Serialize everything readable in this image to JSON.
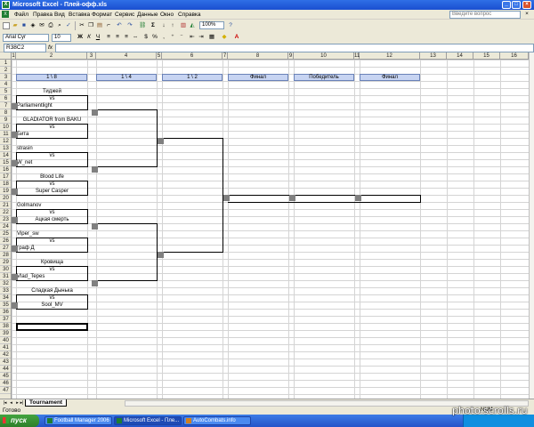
{
  "window": {
    "title": "Microsoft Excel - Плей-офф.xls"
  },
  "menu": [
    "Файл",
    "Правка",
    "Вид",
    "Вставка",
    "Формат",
    "Сервис",
    "Данные",
    "Окно",
    "Справка"
  ],
  "help_placeholder": "Введите вопрос",
  "toolbar": {
    "zoom": "100%",
    "font": "Arial Cyr",
    "font_size": "10"
  },
  "formula_bar": {
    "name_box": "R38C2",
    "fx": "fx",
    "formula": ""
  },
  "columns": [
    "1",
    "2",
    "3",
    "4",
    "5",
    "6",
    "7",
    "8",
    "9",
    "10",
    "11",
    "12",
    "13",
    "14",
    "15",
    "16"
  ],
  "rows": [
    "1",
    "2",
    "3",
    "4",
    "5",
    "6",
    "7",
    "8",
    "9",
    "10",
    "11",
    "12",
    "13",
    "14",
    "15",
    "16",
    "17",
    "18",
    "19",
    "20",
    "21",
    "22",
    "23",
    "24",
    "25",
    "26",
    "27",
    "28",
    "29",
    "30",
    "31",
    "32",
    "33",
    "34",
    "35",
    "36",
    "37",
    "38",
    "39",
    "40",
    "41",
    "42",
    "43",
    "44",
    "45",
    "46",
    "47"
  ],
  "rounds": [
    "1 \\ 8",
    "1 \\ 4",
    "1 \\ 2",
    "Финал",
    "Победитель",
    "Финал"
  ],
  "players": [
    "Тиджей",
    "vs",
    "Parliamentlight",
    "GLADIATOR from BAKU",
    "vs",
    "Бита",
    "strasin",
    "vs",
    "W_net",
    "Blood Life",
    "vs",
    "Super Casper",
    "Golmanov",
    "vs",
    "Ацкая смерть",
    "Viper_sw",
    "vs",
    "граф Д",
    "Кровища",
    "vs",
    "Vlad_Tepes",
    "Сладкая Дынька",
    "vs",
    "Sool_MV"
  ],
  "sheet_tab": "Tournament",
  "status": {
    "left": "Готово",
    "num": "NUM"
  },
  "taskbar": {
    "start": "пуск",
    "tasks": [
      "Football Manager 2006",
      "Microsoft Excel - Пле...",
      "AutoCombats.info"
    ]
  },
  "watermark": "photo.scrolls.ru"
}
